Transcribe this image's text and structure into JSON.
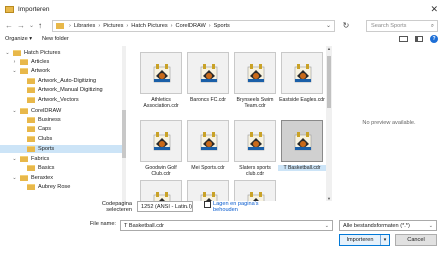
{
  "window": {
    "title": "Importeren",
    "close_glyph": "✕"
  },
  "nav": {
    "back": "←",
    "forward": "→",
    "dropdown": "⌄",
    "up": "↑",
    "refresh": "↻"
  },
  "breadcrumbs": [
    "Libraries",
    "Pictures",
    "Hatch Pictures",
    "CorelDRAW",
    "Sports"
  ],
  "search": {
    "placeholder": "Search Sports"
  },
  "toolbar": {
    "organize": "Organize ▾",
    "new_folder": "New folder",
    "help": "?"
  },
  "tree": [
    {
      "label": "Hatch Pictures",
      "indent": 1,
      "chev": "⌄",
      "selected": false
    },
    {
      "label": "Articles",
      "indent": 2,
      "chev": "›",
      "selected": false
    },
    {
      "label": "Artwork",
      "indent": 2,
      "chev": "⌄",
      "selected": false
    },
    {
      "label": "Artwork_Auto-Digitizing",
      "indent": 3,
      "chev": "",
      "selected": false
    },
    {
      "label": "Artwork_Manual Digitizing",
      "indent": 3,
      "chev": "",
      "selected": false
    },
    {
      "label": "Artwork_Vectors",
      "indent": 3,
      "chev": "",
      "selected": false
    },
    {
      "label": "CorelDRAW",
      "indent": 2,
      "chev": "⌄",
      "selected": false
    },
    {
      "label": "Business",
      "indent": 3,
      "chev": "",
      "selected": false
    },
    {
      "label": "Caps",
      "indent": 3,
      "chev": "",
      "selected": false
    },
    {
      "label": "Clubs",
      "indent": 3,
      "chev": "",
      "selected": false
    },
    {
      "label": "Sports",
      "indent": 3,
      "chev": "",
      "selected": true
    },
    {
      "label": "Fabrics",
      "indent": 2,
      "chev": "⌄",
      "selected": false
    },
    {
      "label": "Basics",
      "indent": 3,
      "chev": "",
      "selected": false
    },
    {
      "label": "Beraxtex",
      "indent": 2,
      "chev": "⌄",
      "selected": false
    },
    {
      "label": "Aubrey Rose",
      "indent": 3,
      "chev": "",
      "selected": false
    }
  ],
  "files": [
    {
      "name": "Athletics Association.cdr",
      "selected": false
    },
    {
      "name": "Baroncs FC.cdr",
      "selected": false
    },
    {
      "name": "Brynseels Swim Team.cdr",
      "selected": false
    },
    {
      "name": "Eastside Eagles.cdr",
      "selected": false
    },
    {
      "name": "Goodwin Golf Club.cdr",
      "selected": false
    },
    {
      "name": "Mei Sports.cdr",
      "selected": false
    },
    {
      "name": "Slaters sports club.cdr",
      "selected": false
    },
    {
      "name": "T Basketball.cdr",
      "selected": true
    },
    {
      "name": "",
      "selected": false
    },
    {
      "name": "",
      "selected": false
    },
    {
      "name": "",
      "selected": false
    }
  ],
  "preview": {
    "message": "No preview available."
  },
  "codepage": {
    "label_line1": "Codepagina",
    "label_line2": "selecteren",
    "value": "1252  (ANSI - Latin I)"
  },
  "checkbox": {
    "label": "Lagen en pagina's behouden",
    "checked": false
  },
  "filename": {
    "label": "File name:",
    "value": "T Basketball.cdr"
  },
  "filetype": {
    "value": "Alle bestandsformaten (*.*)"
  },
  "buttons": {
    "import": "Importeren",
    "cancel": "Cancel"
  },
  "colors": {
    "accent": "#0078d7",
    "selection": "#cce4f7",
    "folder": "#e8b84a"
  }
}
